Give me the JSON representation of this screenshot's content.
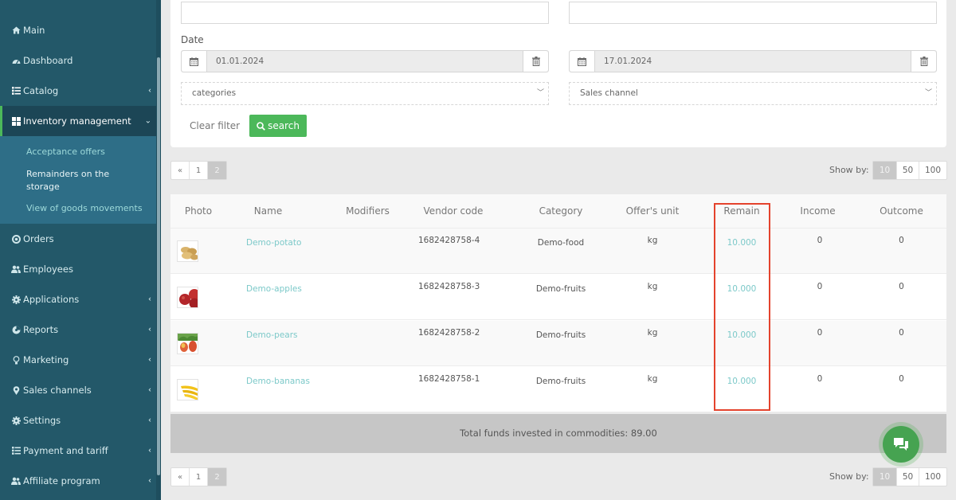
{
  "sidebar": {
    "items": [
      {
        "label": "Main",
        "icon": "home-icon",
        "has_chevron": false
      },
      {
        "label": "Dashboard",
        "icon": "dashboard-icon",
        "has_chevron": false
      },
      {
        "label": "Catalog",
        "icon": "list-icon",
        "has_chevron": true
      },
      {
        "label": "Inventory management",
        "icon": "grid-icon",
        "has_chevron": true,
        "expanded": true
      },
      {
        "label": "Orders",
        "icon": "life-ring-icon",
        "has_chevron": false
      },
      {
        "label": "Employees",
        "icon": "users-icon",
        "has_chevron": false
      },
      {
        "label": "Applications",
        "icon": "gear-icon",
        "has_chevron": true
      },
      {
        "label": "Reports",
        "icon": "pie-chart-icon",
        "has_chevron": true
      },
      {
        "label": "Marketing",
        "icon": "lightbulb-icon",
        "has_chevron": true
      },
      {
        "label": "Sales channels",
        "icon": "map-marker-icon",
        "has_chevron": true
      },
      {
        "label": "Settings",
        "icon": "gear-icon",
        "has_chevron": true
      },
      {
        "label": "Payment and tariff",
        "icon": "list-icon",
        "has_chevron": true
      },
      {
        "label": "Affiliate program",
        "icon": "users-icon",
        "has_chevron": true
      }
    ],
    "submenu": [
      {
        "label": "Acceptance offers"
      },
      {
        "label": "Remainders on the storage",
        "current": true
      },
      {
        "label": "View of goods movements"
      }
    ]
  },
  "filters": {
    "text_input_left": "",
    "text_input_right": "",
    "date_label": "Date",
    "date_from": "01.01.2024",
    "date_to": "17.01.2024",
    "categories_select": "categories",
    "sales_channel_select": "Sales channel",
    "clear_filter_label": "Clear filter",
    "search_label": "search"
  },
  "pagination": {
    "prev": "«",
    "pages": [
      "1",
      "2"
    ],
    "current_page": "2",
    "show_by_label": "Show by:",
    "show_by_options": [
      "10",
      "50",
      "100"
    ],
    "show_by_selected": "10"
  },
  "table": {
    "columns": [
      "Photo",
      "Name",
      "Modifiers",
      "Vendor code",
      "Category",
      "Offer's unit",
      "Remain",
      "Income",
      "Outcome"
    ],
    "rows": [
      {
        "photo": "potato",
        "name": "Demo-potato",
        "modifiers": "",
        "vendor_code": "1682428758-4",
        "category": "Demo-food",
        "unit": "kg",
        "remain": "10.000",
        "income": "0",
        "outcome": "0"
      },
      {
        "photo": "apples",
        "name": "Demo-apples",
        "modifiers": "",
        "vendor_code": "1682428758-3",
        "category": "Demo-fruits",
        "unit": "kg",
        "remain": "10.000",
        "income": "0",
        "outcome": "0"
      },
      {
        "photo": "pears",
        "name": "Demo-pears",
        "modifiers": "",
        "vendor_code": "1682428758-2",
        "category": "Demo-fruits",
        "unit": "kg",
        "remain": "10.000",
        "income": "0",
        "outcome": "0"
      },
      {
        "photo": "bananas",
        "name": "Demo-bananas",
        "modifiers": "",
        "vendor_code": "1682428758-1",
        "category": "Demo-fruits",
        "unit": "kg",
        "remain": "10.000",
        "income": "0",
        "outcome": "0"
      }
    ],
    "total_label": "Total funds invested in commodities: 89.00"
  },
  "colors": {
    "sidebar_bg": "#235869",
    "sidebar_active_bg": "#1c4656",
    "submenu_bg": "#2e6e87",
    "accent_green": "#4cb85a",
    "link_teal": "#7cc9c9",
    "highlight_red": "#e4432d"
  }
}
